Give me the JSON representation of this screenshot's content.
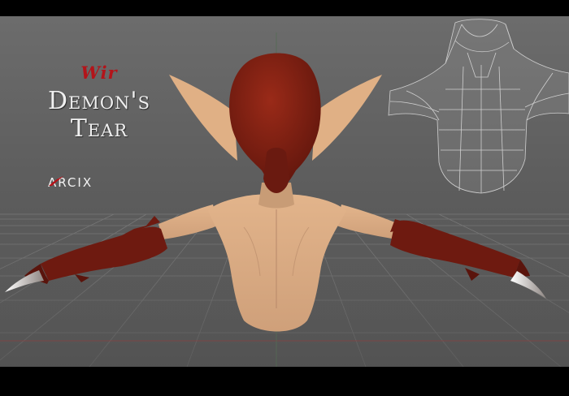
{
  "artwork": {
    "title_prefix": "Wir",
    "title": "Demon's Tear",
    "artist_brand": "ARCIX",
    "accent_color": "#b3141a"
  },
  "scene": {
    "viewport_background": "#5e5e5e",
    "skin_color": "#d8a87e",
    "head_color": "#7a1d12",
    "glove_color": "#6e1a10",
    "claw_color": "#e6e0dc",
    "wireframe_color": "#cfcfcf",
    "grid_color": "#7a7a7a"
  },
  "objects": {
    "character_model": "character-model",
    "wireframe_reference": "wireframe-model"
  }
}
